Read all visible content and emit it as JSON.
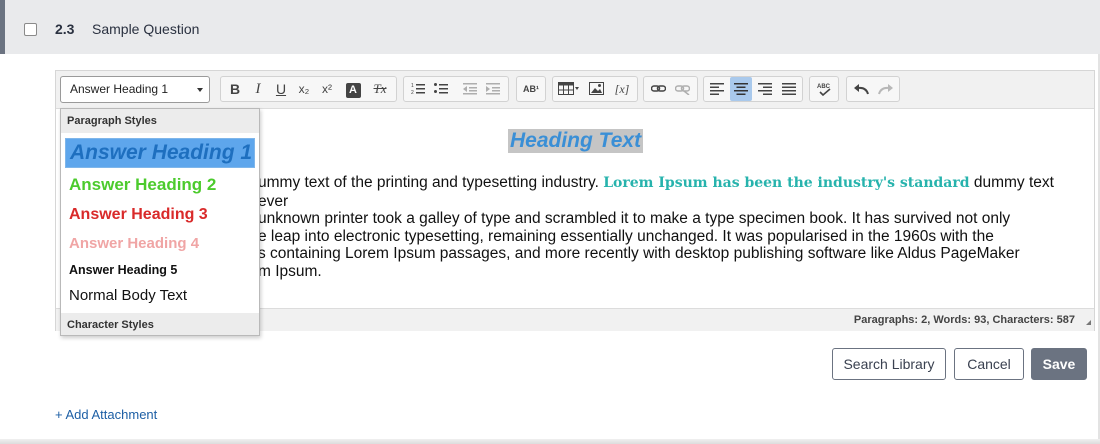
{
  "question": {
    "number": "2.3",
    "title": "Sample Question"
  },
  "toolbar": {
    "style_select_value": "Answer Heading 1",
    "buttons": [
      "bold",
      "italic",
      "underline",
      "subscript",
      "superscript",
      "text-color",
      "remove-format",
      "numbered-list",
      "bulleted-list",
      "decrease-indent",
      "increase-indent",
      "style-indicator",
      "table",
      "image",
      "variable",
      "link",
      "unlink",
      "align-left",
      "align-center",
      "align-right",
      "justify",
      "spellcheck",
      "undo",
      "redo"
    ],
    "labels": {
      "bold": "B",
      "italic": "I",
      "underline": "U",
      "subscript": "x₂",
      "superscript": "x²",
      "text_color": "A",
      "remove_format": "Tx",
      "style_indicator": "AB¹",
      "variable": "[x]"
    }
  },
  "editor": {
    "heading": "Heading Text",
    "lines": [
      {
        "before": "ummy text of the printing and typesetting industry. ",
        "highlight": "Lorem Ipsum has been the industry's standard",
        "after": " dummy text ever"
      },
      {
        "text": " unknown printer took a galley of type and scrambled it to make a type specimen book. It has survived not only"
      },
      {
        "text": "e leap into electronic typesetting, remaining essentially unchanged. It was popularised in the 1960s with the"
      },
      {
        "text": "s containing Lorem Ipsum passages, and more recently with desktop publishing software like Aldus PageMaker"
      },
      {
        "text": "m Ipsum."
      }
    ],
    "status": "Paragraphs: 2, Words: 93, Characters: 587"
  },
  "dropdown": {
    "section_paragraph": "Paragraph Styles",
    "items": [
      "Answer Heading 1",
      "Answer Heading 2",
      "Answer Heading 3",
      "Answer Heading 4",
      "Answer Heading 5",
      "Normal Body Text"
    ],
    "section_character": "Character Styles"
  },
  "actions": {
    "search_library": "Search Library",
    "cancel": "Cancel",
    "save": "Save"
  },
  "attachment": {
    "label": "+ Add Attachment"
  },
  "colors": {
    "header_bg": "#e9eaec",
    "accent": "#6b7381",
    "link": "#1d5fa5",
    "heading1": "#3a8fd6",
    "heading2": "#4ccb2d",
    "heading3": "#d92a2a",
    "heading4": "#f0a5a5",
    "highlight_text": "#27b3ad"
  }
}
